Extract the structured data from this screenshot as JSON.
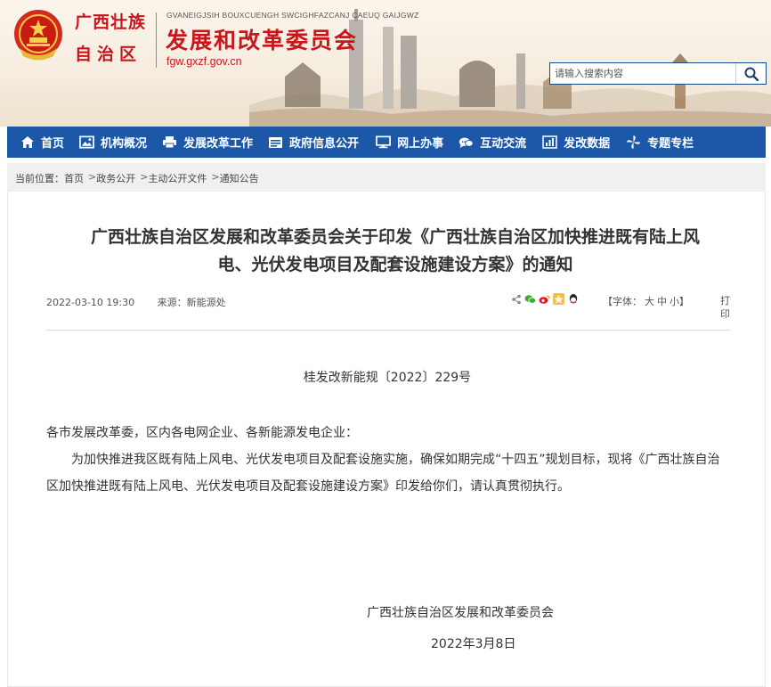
{
  "header": {
    "region_line1": "广西壮族",
    "region_line2": "自治区",
    "zhuang_name": "GVANEIGJSIH BOUXCUENGH SWCIGHFAZCANJ CAEUQ GAIJGWZ",
    "agency_name": "发展和改革委员会",
    "domain": "fgw.gxzf.gov.cn",
    "search_placeholder": "请输入搜索内容",
    "brand_red": "#c8161d"
  },
  "nav": {
    "color": "#1d58a8",
    "items": [
      {
        "label": "首页",
        "icon": "home-icon"
      },
      {
        "label": "机构概况",
        "icon": "image-icon"
      },
      {
        "label": "发展改革工作",
        "icon": "printer-icon"
      },
      {
        "label": "政府信息公开",
        "icon": "folder-icon"
      },
      {
        "label": "网上办事",
        "icon": "monitor-icon"
      },
      {
        "label": "互动交流",
        "icon": "chat-icon"
      },
      {
        "label": "发改数据",
        "icon": "bar-chart-icon"
      },
      {
        "label": "专题专栏",
        "icon": "pinwheel-icon"
      }
    ]
  },
  "breadcrumb": {
    "prefix": "当前位置：",
    "items": [
      "首页",
      "政务公开",
      "主动公开文件",
      "通知公告"
    ],
    "separator": ">"
  },
  "article": {
    "title_line1": "广西壮族自治区发展和改革委员会关于印发《广西壮族自治区加快推进既有陆上风",
    "title_line2": "电、光伏发电项目及配套设施建设方案》的通知",
    "date": "2022-03-10 19:30",
    "source": "来源：新能源处",
    "font_size_label": "【字体：",
    "font_sizes": [
      "大",
      "中",
      "小"
    ],
    "font_size_close": "】",
    "print_label": "打印",
    "share_icons": [
      "share-icon",
      "wechat-icon",
      "weibo-icon",
      "qzone-icon",
      "qq-icon"
    ],
    "doc_number": "桂发改新能规〔2022〕229号",
    "salutation": "各市发展改革委，区内各电网企业、各新能源发电企业：",
    "paragraph": "为加快推进我区既有陆上风电、光伏发电项目及配套设施实施，确保如期完成“十四五”规划目标，现将《广西壮族自治区加快推进既有陆上风电、光伏发电项目及配套设施建设方案》印发给你们，请认真贯彻执行。",
    "signature": "广西壮族自治区发展和改革委员会",
    "sign_date": "2022年3月8日"
  }
}
